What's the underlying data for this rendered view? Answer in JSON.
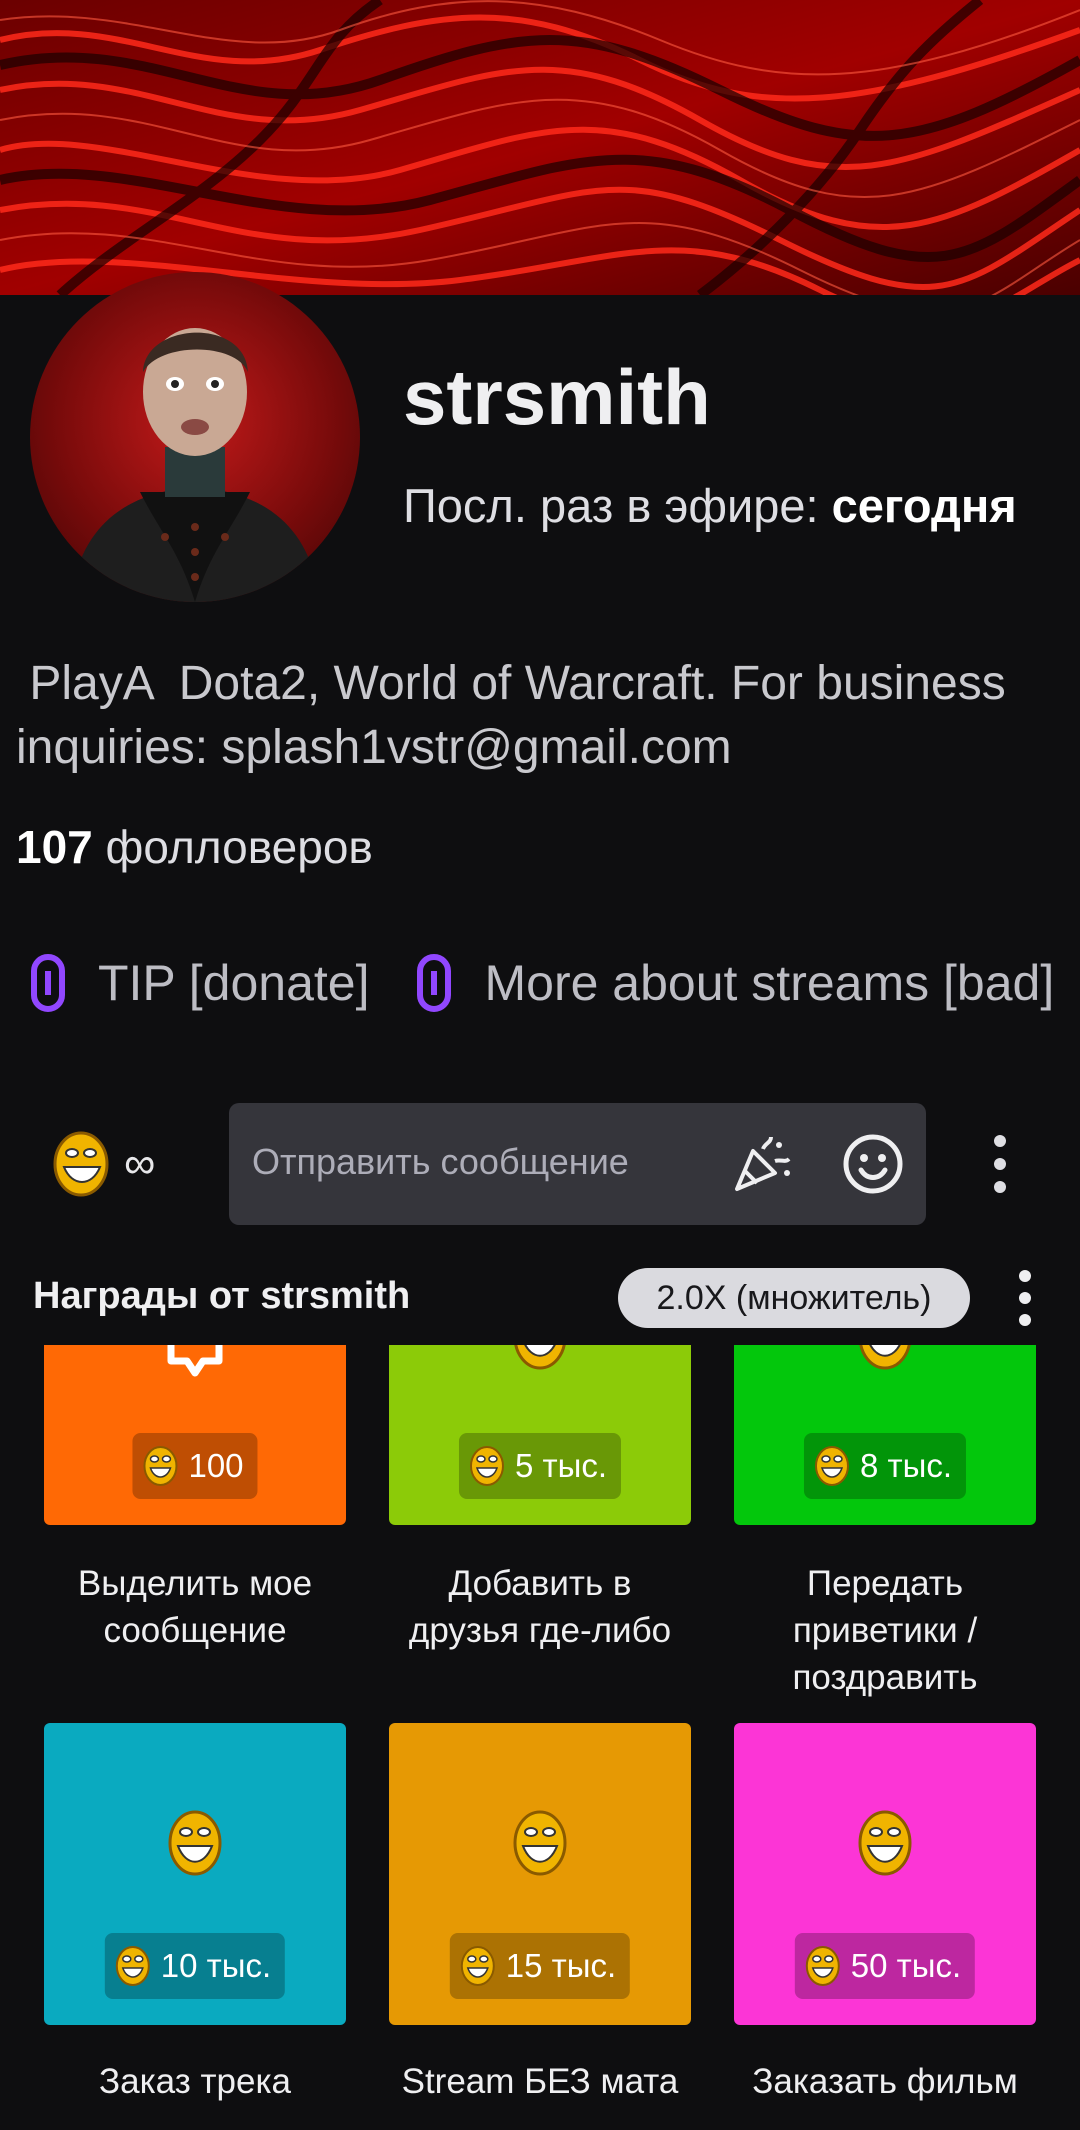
{
  "profile": {
    "username": "strsmith",
    "last_live_prefix": "Посл. раз в эфире: ",
    "last_live_value": "сегодня",
    "bio_line1": " PlayA  Dota2, World of Warcraft. For business",
    "bio_line2": "inquiries: splash1vstr@gmail.com",
    "followers_count": "107",
    "followers_label": " фолловеров"
  },
  "links": [
    {
      "label": "TIP [donate]",
      "icon": "link-icon"
    },
    {
      "label": "More about streams [bad]",
      "icon": "link-icon"
    }
  ],
  "chat": {
    "points_value": "∞",
    "placeholder": "Отправить сообщение",
    "icons": [
      "channel-points-emote",
      "party-popper-icon",
      "smiley-icon",
      "more-vertical-icon"
    ]
  },
  "rewards": {
    "title": "Награды от strsmith",
    "multiplier": "2.0X (множитель)",
    "items": [
      {
        "cost": "100",
        "label_line1": "Выделить мое",
        "label_line2": "сообщение",
        "label_line3": "",
        "color": "#ff6905"
      },
      {
        "cost": "5 тыс.",
        "label_line1": "Добавить в",
        "label_line2": "друзья где-либо",
        "label_line3": "",
        "color": "#8ccb08"
      },
      {
        "cost": "8 тыс.",
        "label_line1": "Передать",
        "label_line2": "приветики /",
        "label_line3": "поздравить",
        "color": "#03c70c"
      },
      {
        "cost": "10 тыс.",
        "label_line1": "Заказ трека",
        "label_line2": "",
        "label_line3": "",
        "color": "#0aaac0"
      },
      {
        "cost": "15 тыс.",
        "label_line1": "Stream БЕЗ мата",
        "label_line2": "",
        "label_line3": "",
        "color": "#e69904"
      },
      {
        "cost": "50 тыс.",
        "label_line1": "Заказать фильм",
        "label_line2": "",
        "label_line3": "",
        "color": "#fc35d6"
      }
    ]
  },
  "colors": {
    "background": "#0e0e10",
    "accent_purple": "#9147ff",
    "input_bg": "#35353b",
    "banner_red": "#d10000"
  }
}
